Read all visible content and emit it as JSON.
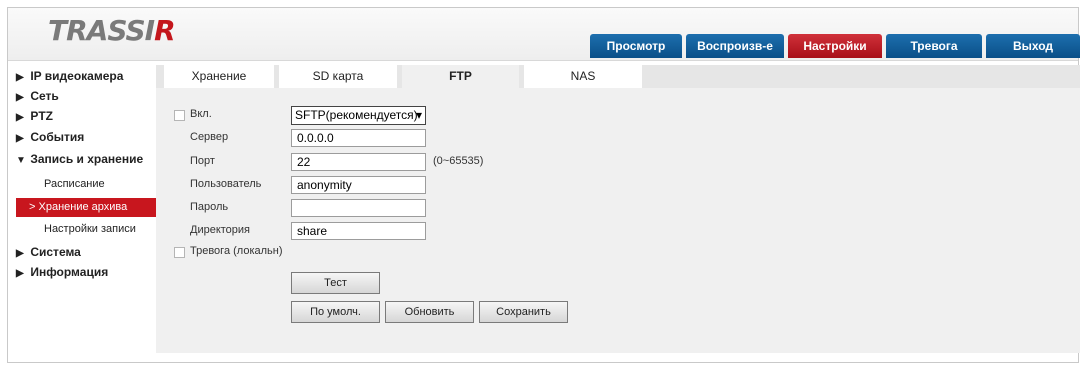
{
  "logo": {
    "main": "TRASSI",
    "accent": "R"
  },
  "nav": {
    "tabs": [
      {
        "label": "Просмотр",
        "active": false
      },
      {
        "label": "Воспроизв-е",
        "active": false
      },
      {
        "label": "Настройки",
        "active": true
      },
      {
        "label": "Тревога",
        "active": false
      },
      {
        "label": "Выход",
        "active": false
      }
    ]
  },
  "sidebar": {
    "items": [
      {
        "label": "IP видеокамера",
        "expanded": false
      },
      {
        "label": "Сеть",
        "expanded": false
      },
      {
        "label": "PTZ",
        "expanded": false
      },
      {
        "label": "События",
        "expanded": false
      },
      {
        "label": "Запись и хранение",
        "expanded": true
      },
      {
        "label": "Система",
        "expanded": false
      },
      {
        "label": "Информация",
        "expanded": false
      }
    ],
    "subitems": [
      {
        "label": "Расписание",
        "active": false
      },
      {
        "label": "Хранение архива",
        "active": true
      },
      {
        "label": "Настройки записи",
        "active": false
      }
    ],
    "expanded_icon": "▼",
    "collapsed_icon": "▶",
    "active_icon": ">"
  },
  "subtabs": [
    {
      "label": "Хранение",
      "active": false
    },
    {
      "label": "SD карта",
      "active": false
    },
    {
      "label": "FTP",
      "active": true
    },
    {
      "label": "NAS",
      "active": false
    }
  ],
  "form": {
    "enable": {
      "label": "Вкл.",
      "checked": false
    },
    "protocol": {
      "value": "SFTP(рекомендуется)"
    },
    "server": {
      "label": "Сервер",
      "value": "0.0.0.0"
    },
    "port": {
      "label": "Порт",
      "value": "22",
      "hint": "(0~65535)"
    },
    "user": {
      "label": "Пользователь",
      "value": "anonymity"
    },
    "password": {
      "label": "Пароль",
      "value": ""
    },
    "directory": {
      "label": "Директория",
      "value": "share"
    },
    "alarm": {
      "label": "Тревога (локальн)",
      "checked": false
    }
  },
  "buttons": {
    "test": "Тест",
    "default": "По умолч.",
    "refresh": "Обновить",
    "save": "Сохранить"
  },
  "colors": {
    "accent_red": "#c8161e",
    "nav_blue": "#0a4f88"
  }
}
